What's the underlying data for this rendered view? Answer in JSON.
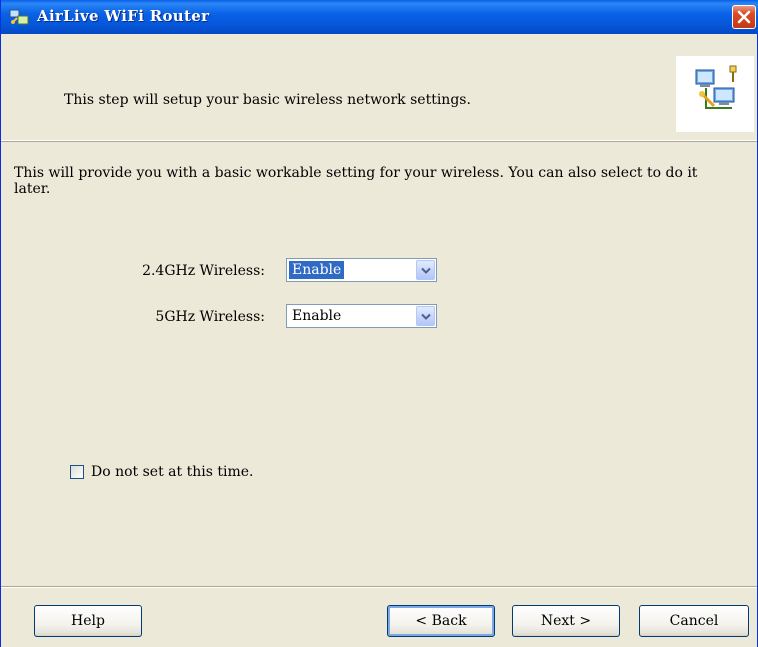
{
  "window": {
    "title": "AirLive WiFi Router"
  },
  "header": {
    "text": "This step will setup your basic wireless network settings."
  },
  "main": {
    "description": "This will provide you with a basic workable setting for your wireless. You can also select to do it later.",
    "fields": [
      {
        "label": "2.4GHz Wireless:",
        "value": "Enable"
      },
      {
        "label": "5GHz Wireless:",
        "value": "Enable"
      }
    ],
    "skip_checkbox": {
      "label": "Do not set at this time.",
      "checked": false
    }
  },
  "buttons": {
    "help": "Help",
    "back": "< Back",
    "next": "Next >",
    "cancel": "Cancel"
  },
  "icons": {
    "app": "network-router-icon",
    "header": "network-computers-icon",
    "close": "close-icon",
    "dropdown": "chevron-down-icon"
  },
  "colors": {
    "titlebar": "#0a5ee8",
    "dialog_bg": "#ece9d8",
    "selection": "#316ac5",
    "close_button": "#d94c25"
  }
}
